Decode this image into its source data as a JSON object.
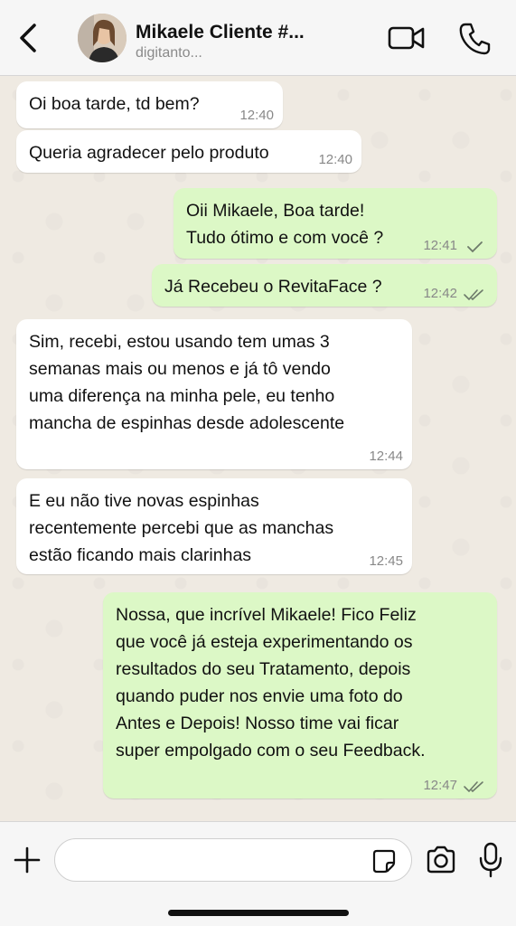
{
  "header": {
    "contact_name": "Mikaele Cliente #...",
    "status": "digitanto..."
  },
  "messages": [
    {
      "direction": "in",
      "text": "Oi boa tarde, td bem?",
      "time": "12:40"
    },
    {
      "direction": "in",
      "text": "Queria agradecer pelo produto",
      "time": "12:40"
    },
    {
      "direction": "out",
      "text": "Oii Mikaele, Boa tarde!\nTudo ótimo e com você ?",
      "time": "12:41",
      "status": "sent"
    },
    {
      "direction": "out",
      "text": "Já Recebeu o RevitaFace ?",
      "time": "12:42",
      "status": "delivered"
    },
    {
      "direction": "in",
      "text": "Sim, recebi, estou usando tem umas 3\nsemanas mais ou menos e já tô vendo\numa diferença na minha pele, eu tenho\nmancha de espinhas desde adolescente",
      "time": "12:44"
    },
    {
      "direction": "in",
      "text": "E eu não tive novas espinhas\nrecentemente percebi que as manchas\nestão ficando mais clarinhas",
      "time": "12:45"
    },
    {
      "direction": "out",
      "text": "Nossa, que incrível Mikaele!  Fico Feliz\nque você já esteja experimentando os\nresultados do seu Tratamento, depois\nquando puder nos envie uma foto do\nAntes e Depois!  Nosso time vai ficar\nsuper empolgado com o seu Feedback.",
      "time": "12:47",
      "status": "delivered"
    }
  ],
  "composer": {
    "placeholder": ""
  },
  "icons": {
    "back": "chevron-left-icon",
    "video": "video-camera-icon",
    "call": "phone-icon",
    "plus": "plus-icon",
    "sticker": "sticker-icon",
    "camera": "camera-icon",
    "mic": "microphone-icon"
  },
  "colors": {
    "incoming_bubble": "#ffffff",
    "outgoing_bubble": "#dcf8c6",
    "chat_background": "#efeae2",
    "header_background": "#f6f6f6"
  }
}
